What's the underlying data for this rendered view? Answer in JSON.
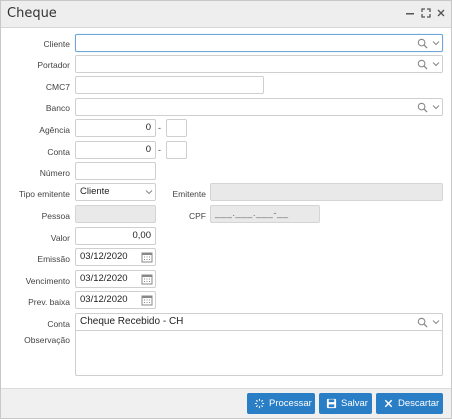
{
  "window": {
    "title": "Cheque"
  },
  "form": {
    "cliente": {
      "label": "Cliente",
      "value": ""
    },
    "portador": {
      "label": "Portador",
      "value": ""
    },
    "cmc7": {
      "label": "CMC7",
      "value": ""
    },
    "banco": {
      "label": "Banco",
      "value": ""
    },
    "agencia": {
      "label": "Agência",
      "value": "0",
      "digit": "",
      "separator": "-"
    },
    "conta_num": {
      "label": "Conta",
      "value": "0",
      "digit": "",
      "separator": "-"
    },
    "numero": {
      "label": "Número",
      "value": ""
    },
    "tipo_emitente": {
      "label": "Tipo emitente",
      "value": "Cliente"
    },
    "emitente": {
      "label": "Emitente",
      "value": ""
    },
    "pessoa": {
      "label": "Pessoa",
      "value": ""
    },
    "cpf": {
      "label": "CPF",
      "value": "___.___.___-__"
    },
    "valor": {
      "label": "Valor",
      "value": "0,00"
    },
    "emissao": {
      "label": "Emissão",
      "value": "03/12/2020"
    },
    "vencimento": {
      "label": "Vencimento",
      "value": "03/12/2020"
    },
    "prev_baixa": {
      "label": "Prev. baixa",
      "value": "03/12/2020"
    },
    "conta": {
      "label": "Conta",
      "value": "Cheque Recebido - CH"
    },
    "observacao": {
      "label": "Observação",
      "value": ""
    }
  },
  "footer": {
    "processar_label": "Processar",
    "salvar_label": "Salvar",
    "descartar_label": "Descartar"
  },
  "colors": {
    "primary_button": "#2a7ec5",
    "focus_border": "#6ea7d8",
    "disabled_bg": "#e9e9e9"
  },
  "icons": [
    "minimize-icon",
    "maximize-icon",
    "close-icon",
    "search-icon",
    "chevron-down-icon",
    "calendar-icon",
    "processar-icon",
    "save-icon",
    "discard-icon"
  ]
}
